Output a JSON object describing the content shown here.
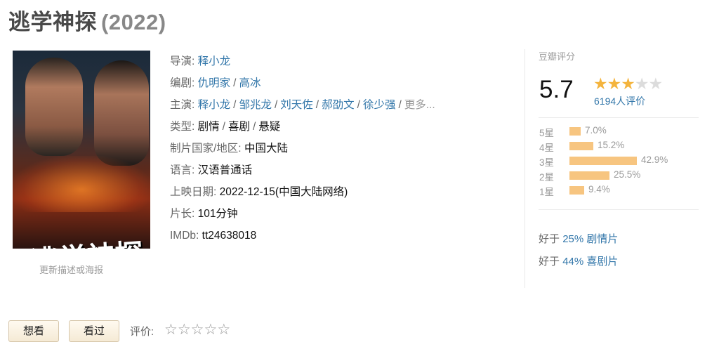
{
  "movie": {
    "title": "逃学神探",
    "year": "(2022)"
  },
  "poster": {
    "title_text": "逃学神探",
    "update_link": "更新描述或海报"
  },
  "info": {
    "director_label": "导演:",
    "directors": [
      "释小龙"
    ],
    "writer_label": "编剧:",
    "writers": [
      "仇明家",
      "高冰"
    ],
    "cast_label": "主演:",
    "cast": [
      "释小龙",
      "邹兆龙",
      "刘天佐",
      "郝劭文",
      "徐少强"
    ],
    "cast_more": "更多...",
    "genre_label": "类型:",
    "genres": [
      "剧情",
      "喜剧",
      "悬疑"
    ],
    "country_label": "制片国家/地区:",
    "country": "中国大陆",
    "language_label": "语言:",
    "language": "汉语普通话",
    "release_label": "上映日期:",
    "release": "2022-12-15(中国大陆网络)",
    "runtime_label": "片长:",
    "runtime": "101分钟",
    "imdb_label": "IMDb:",
    "imdb": "tt24638018"
  },
  "rating": {
    "header": "豆瓣评分",
    "score": "5.7",
    "stars_filled": 3,
    "stars_total": 5,
    "count_text": "6194人评价",
    "breakdown": [
      {
        "label": "5星",
        "percent": 7.0,
        "percent_text": "7.0%"
      },
      {
        "label": "4星",
        "percent": 15.2,
        "percent_text": "15.2%"
      },
      {
        "label": "3星",
        "percent": 42.9,
        "percent_text": "42.9%"
      },
      {
        "label": "2星",
        "percent": 25.5,
        "percent_text": "25.5%"
      },
      {
        "label": "1星",
        "percent": 9.4,
        "percent_text": "9.4%"
      }
    ],
    "better_than": [
      {
        "prefix": "好于",
        "value": "25% 剧情片"
      },
      {
        "prefix": "好于",
        "value": "44% 喜剧片"
      }
    ]
  },
  "actions": {
    "want_label": "想看",
    "seen_label": "看过",
    "rate_label": "评价:",
    "rate_star_glyph": "☆"
  },
  "colors": {
    "link": "#3377aa",
    "star": "#f4b43d",
    "bar": "#f7c580"
  }
}
